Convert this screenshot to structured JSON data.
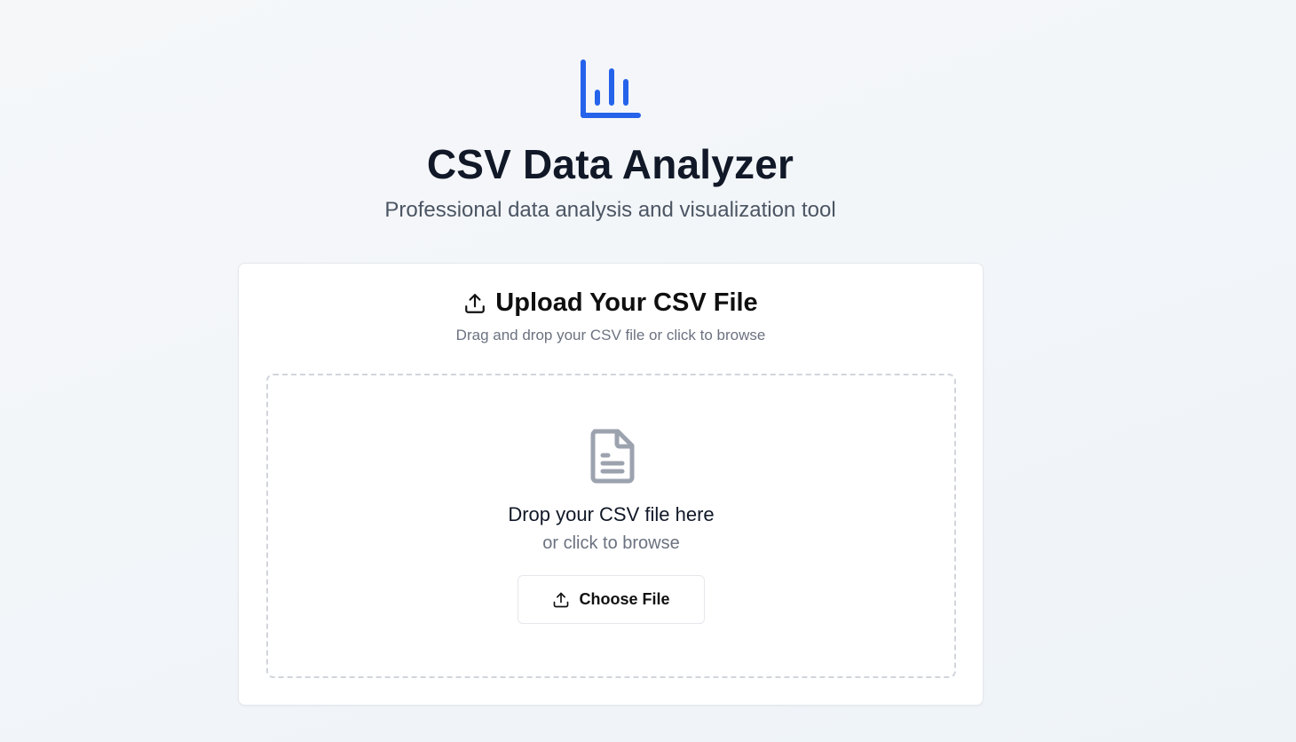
{
  "header": {
    "icon": "bar-chart-icon",
    "title": "CSV Data Analyzer",
    "subtitle": "Professional data analysis and visualization tool"
  },
  "upload_card": {
    "icon": "upload-icon",
    "title": "Upload Your CSV File",
    "description": "Drag and drop your CSV file or click to browse",
    "dropzone": {
      "icon": "file-text-icon",
      "title": "Drop your CSV file here",
      "subtitle": "or click to browse",
      "button": {
        "icon": "upload-icon",
        "label": "Choose File"
      }
    }
  },
  "colors": {
    "accent": "#2563eb",
    "title_text": "#111827",
    "muted_text": "#6b7280",
    "icon_gray": "#9ca3af"
  }
}
